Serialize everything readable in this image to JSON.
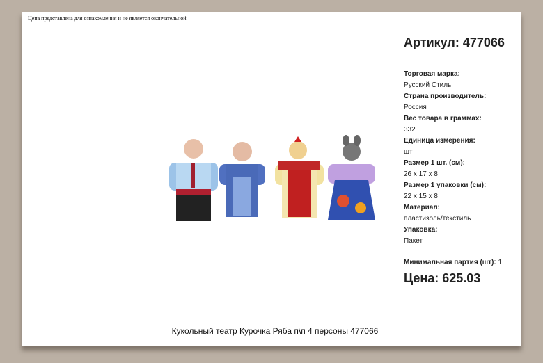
{
  "disclaimer": "Цена представлена для ознакомления и не является окончательной.",
  "article": "Артикул: 477066",
  "properties": [
    {
      "key": "Торговая марка:",
      "value": "Русский Стиль"
    },
    {
      "key": "Страна производитель:",
      "value": "Россия"
    },
    {
      "key": "Вес товара в граммах:",
      "value": "332"
    },
    {
      "key": "Единица измерения:",
      "value": "шт"
    },
    {
      "key": "Размер 1 шт. (см):",
      "value": "26 х 17 х 8"
    },
    {
      "key": "Размер 1 упаковки (см):",
      "value": "22 х 15 х 8"
    },
    {
      "key": "Материал:",
      "value": "пластизоль/текстиль"
    },
    {
      "key": "Упаковка:",
      "value": "Пакет"
    }
  ],
  "min_lot_label": "Минимальная партия (шт):",
  "min_lot_value": "1",
  "price": "Цена: 625.03",
  "caption": "Кукольный театр Курочка Ряба п\\п 4 персоны 477066"
}
